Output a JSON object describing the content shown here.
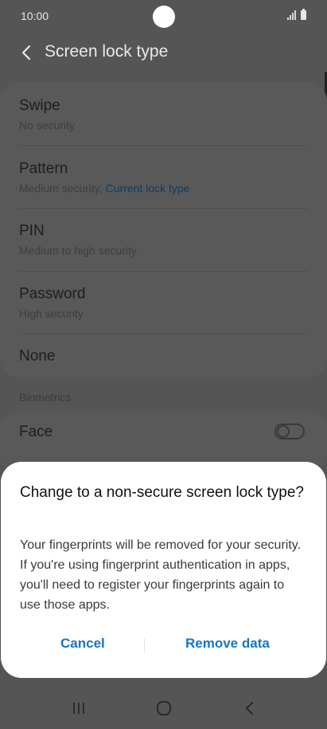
{
  "status_bar": {
    "time": "10:00"
  },
  "app_bar": {
    "title": "Screen lock type"
  },
  "options": [
    {
      "label": "Swipe",
      "sub": "No security"
    },
    {
      "label": "Pattern",
      "sub": "Medium security, ",
      "sub_accent": "Current lock type"
    },
    {
      "label": "PIN",
      "sub": "Medium to high security"
    },
    {
      "label": "Password",
      "sub": "High security"
    },
    {
      "label": "None"
    }
  ],
  "biometrics": {
    "header": "Biometrics",
    "face": {
      "label": "Face",
      "enabled": false
    }
  },
  "dialog": {
    "title": "Change to a non-secure screen lock type?",
    "body": "Your fingerprints will be removed for your security. If you're using fingerprint authentication in apps, you'll need to register your fingerprints again to use those apps.",
    "cancel_label": "Cancel",
    "confirm_label": "Remove data"
  },
  "colors": {
    "accent": "#1577c4",
    "scrim_background": "#555555",
    "dialog_background": "#ffffff"
  },
  "icons": {
    "back": "chevron-left-icon",
    "nav_recents": "recents-icon",
    "nav_home": "home-icon",
    "nav_back": "back-icon"
  }
}
